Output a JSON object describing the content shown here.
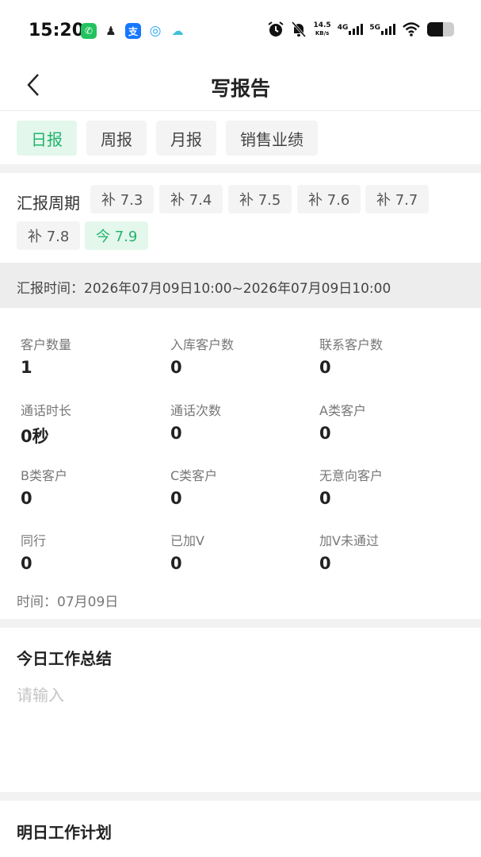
{
  "status_bar": {
    "time": "15:20",
    "app_icons": [
      {
        "name": "wechat-icon",
        "glyph": "✆",
        "color": "#22c35e"
      },
      {
        "name": "qq-icon",
        "glyph": "♟",
        "color": "#222222"
      },
      {
        "name": "alipay-icon",
        "glyph": "支",
        "color": "#1677ff"
      },
      {
        "name": "browser-icon",
        "glyph": "◎",
        "color": "#2aa4f4"
      },
      {
        "name": "cloud-icon",
        "glyph": "☁",
        "color": "#3fbfd8"
      }
    ],
    "net_speed": "14.5",
    "net_unit": "KB/s",
    "signal_1": "4G",
    "signal_2": "5G"
  },
  "header": {
    "title": "写报告"
  },
  "tabs": [
    {
      "label": "日报",
      "active": true
    },
    {
      "label": "周报",
      "active": false
    },
    {
      "label": "月报",
      "active": false
    },
    {
      "label": "销售业绩",
      "active": false
    }
  ],
  "period": {
    "label": "汇报周期",
    "chips": [
      {
        "label": "补 7.3",
        "active": false
      },
      {
        "label": "补 7.4",
        "active": false
      },
      {
        "label": "补 7.5",
        "active": false
      },
      {
        "label": "补 7.6",
        "active": false
      },
      {
        "label": "补 7.7",
        "active": false
      },
      {
        "label": "补 7.8",
        "active": false
      },
      {
        "label": "今 7.9",
        "active": true
      }
    ]
  },
  "report_time": "汇报时间：2026年07月09日10:00~2026年07月09日10:00",
  "stats": [
    {
      "label": "客户数量",
      "value": "1"
    },
    {
      "label": "入库客户数",
      "value": "0"
    },
    {
      "label": "联系客户数",
      "value": "0"
    },
    {
      "label": "通话时长",
      "value": "0秒"
    },
    {
      "label": "通话次数",
      "value": "0"
    },
    {
      "label": "A类客户",
      "value": "0"
    },
    {
      "label": "B类客户",
      "value": "0"
    },
    {
      "label": "C类客户",
      "value": "0"
    },
    {
      "label": "无意向客户",
      "value": "0"
    },
    {
      "label": "同行",
      "value": "0"
    },
    {
      "label": "已加V",
      "value": "0"
    },
    {
      "label": "加V未通过",
      "value": "0"
    }
  ],
  "date_note": "时间：07月09日",
  "summary": {
    "title": "今日工作总结",
    "placeholder": "请输入"
  },
  "plan": {
    "title": "明日工作计划"
  },
  "colors": {
    "accent": "#21b36b",
    "accent_bg": "#e4f7ed"
  }
}
